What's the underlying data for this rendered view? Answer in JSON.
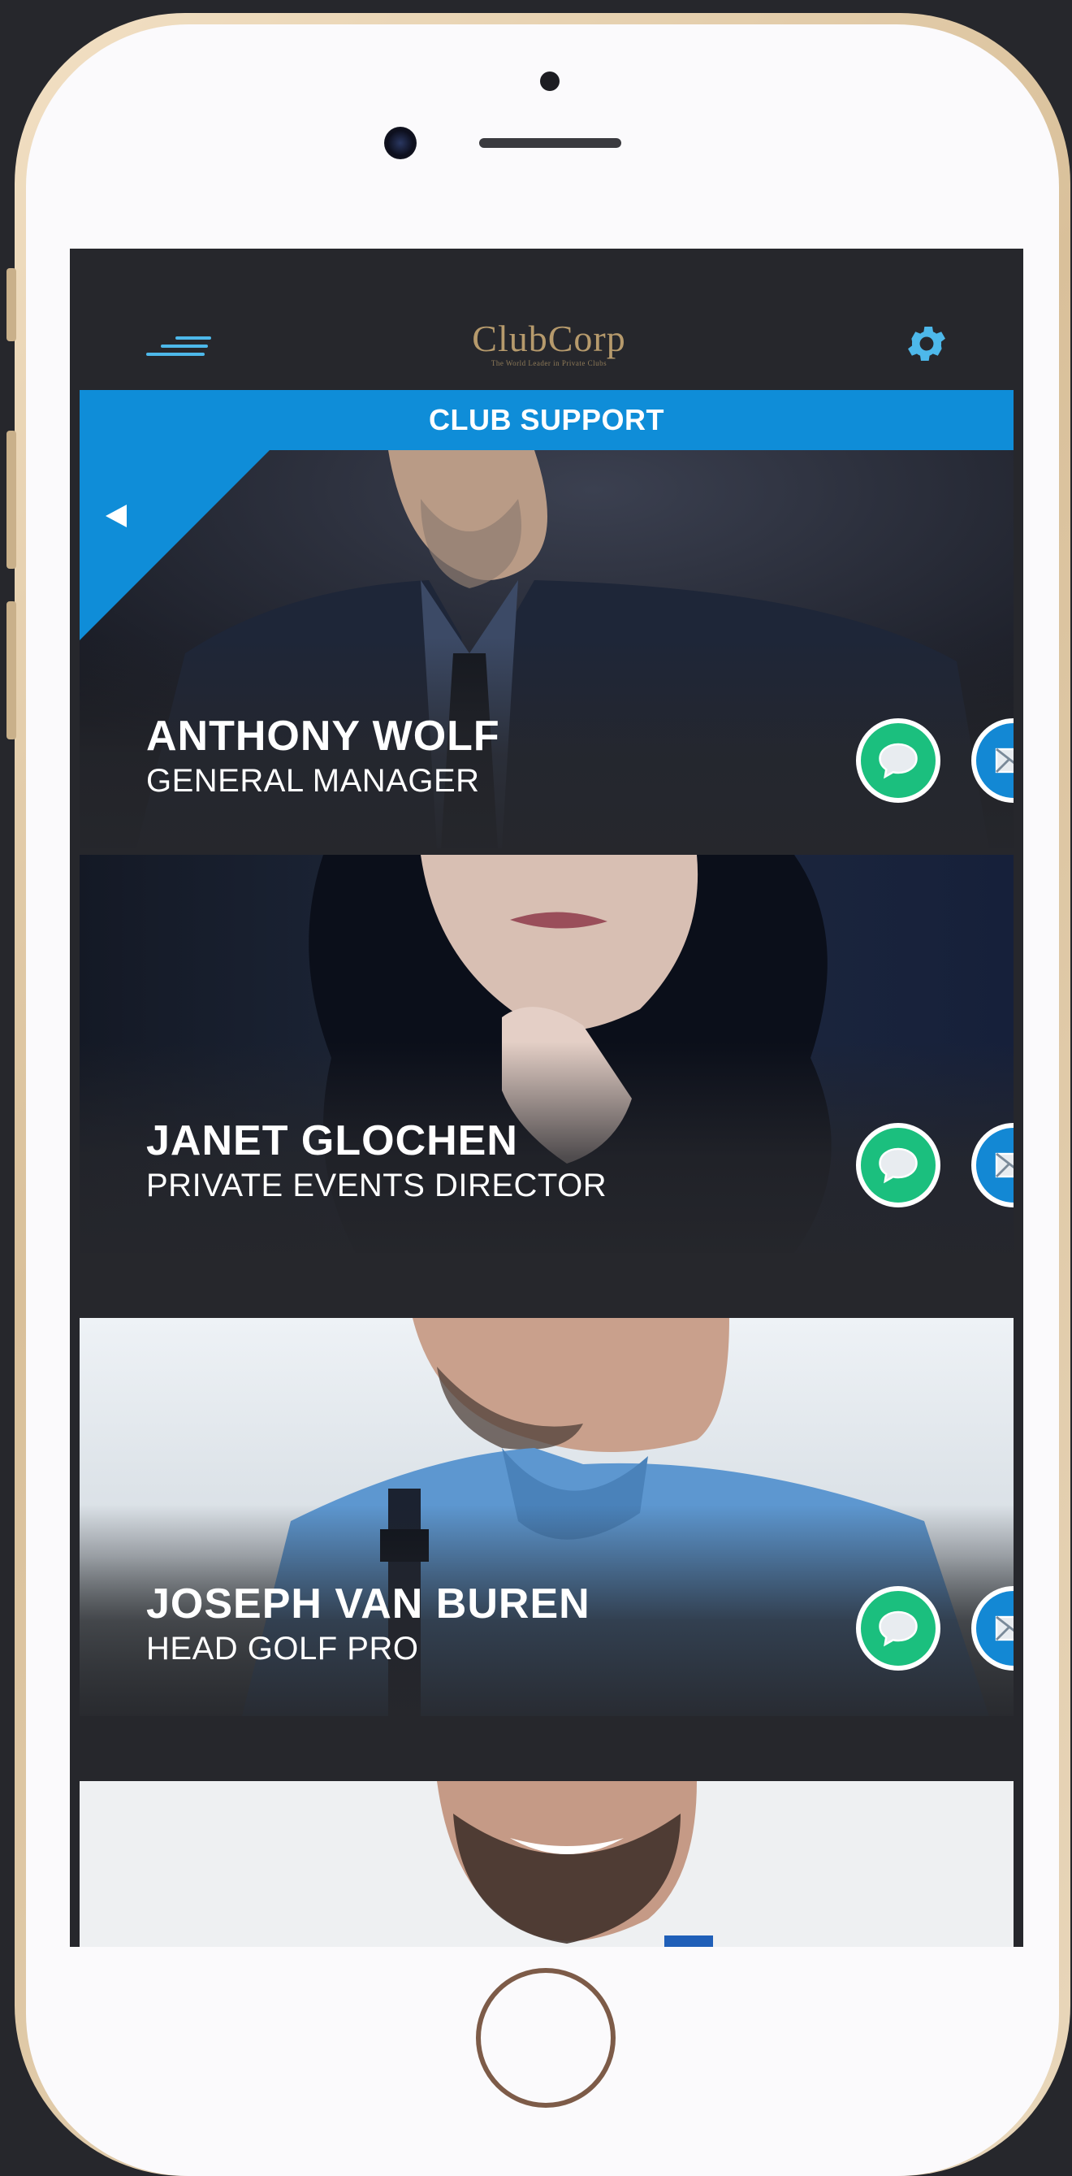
{
  "app": {
    "logo_name": "ClubCorp",
    "logo_tagline": "The World Leader in Private Clubs",
    "menu_icon": "hamburger-menu-icon",
    "settings_icon": "gear-icon"
  },
  "banner": {
    "title": "CLUB SUPPORT"
  },
  "contacts": [
    {
      "name": "ANTHONY WOLF",
      "role": "GENERAL MANAGER",
      "chat_icon": "chat-bubble-icon",
      "mail_icon": "envelope-icon"
    },
    {
      "name": "JANET GLOCHEN",
      "role": "PRIVATE EVENTS DIRECTOR",
      "chat_icon": "chat-bubble-icon",
      "mail_icon": "envelope-icon"
    },
    {
      "name": "JOSEPH VAN BUREN",
      "role": "HEAD GOLF PRO",
      "chat_icon": "chat-bubble-icon",
      "mail_icon": "envelope-icon"
    }
  ],
  "colors": {
    "accent_blue": "#0f8dd8",
    "chat_green": "#1bbf7e",
    "mail_blue": "#1388d4",
    "logo_gold": "#b69a6c",
    "background": "#26272c"
  }
}
